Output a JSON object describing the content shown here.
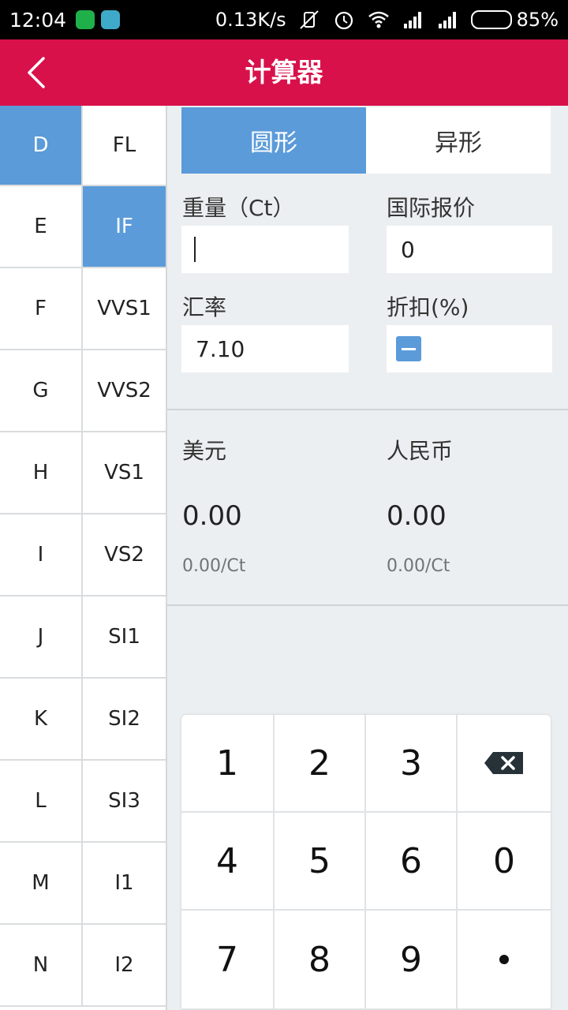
{
  "status_bar": {
    "time": "12:04",
    "net_speed": "0.13K/s",
    "battery": "85%",
    "battery_level": 0.85,
    "icons": [
      "wechat-icon",
      "qq-icon",
      "vibrate-off-icon",
      "alarm-icon",
      "wifi-icon",
      "signal-icon",
      "signal-icon",
      "battery-icon"
    ]
  },
  "header": {
    "title": "计算器",
    "back_icon": "chevron-left-icon",
    "bg_color": "#d8114a"
  },
  "colors": {
    "accent": "#5b9bd9"
  },
  "grid": {
    "color_grades": [
      "D",
      "E",
      "F",
      "G",
      "H",
      "I",
      "J",
      "K",
      "L",
      "M",
      "N"
    ],
    "clarity_grades": [
      "FL",
      "IF",
      "VVS1",
      "VVS2",
      "VS1",
      "VS2",
      "SI1",
      "SI2",
      "SI3",
      "I1",
      "I2"
    ],
    "selected_color": "D",
    "selected_clarity": "IF"
  },
  "shape_tabs": {
    "round": "圆形",
    "fancy": "异形",
    "active": "圆形"
  },
  "form": {
    "weight_label": "重量（Ct）",
    "weight_value": "",
    "intl_price_label": "国际报价",
    "intl_price_value": "0",
    "rate_label": "汇率",
    "rate_value": "7.10",
    "discount_label": "折扣(%)",
    "discount_value": ""
  },
  "results": {
    "usd_label": "美元",
    "usd_value": "0.00",
    "usd_per_ct": "0.00/Ct",
    "cny_label": "人民币",
    "cny_value": "0.00",
    "cny_per_ct": "0.00/Ct"
  },
  "keypad": {
    "keys": [
      "1",
      "2",
      "3",
      "backspace",
      "4",
      "5",
      "6",
      "0",
      "7",
      "8",
      "9",
      "."
    ]
  }
}
